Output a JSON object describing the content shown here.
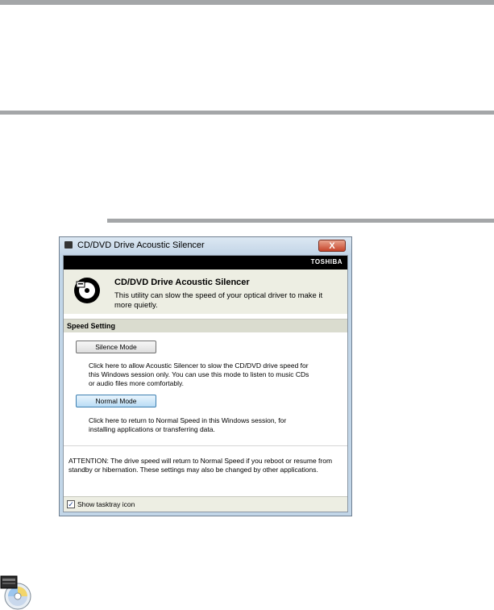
{
  "window": {
    "title": "CD/DVD Drive Acoustic Silencer",
    "close_glyph": "X",
    "brand": "TOSHIBA"
  },
  "header": {
    "title": "CD/DVD Drive Acoustic Silencer",
    "description": "This utility can slow  the speed of  your optical driver to make it more quietly.",
    "icon": "disc-icon"
  },
  "speed_setting": {
    "title": "Speed Setting",
    "silence_button": "Silence Mode",
    "silence_description": "Click here to allow Acoustic Silencer to slow the CD/DVD drive speed for this Windows session only. You can use this mode to listen to music CDs or audio files more comfortably.",
    "normal_button": "Normal Mode",
    "normal_description": "Click here to return to Normal Speed in this Windows session, for installing applications or transferring data."
  },
  "attention": "ATTENTION: The drive speed will return to Normal Speed if you reboot or resume from standby or hibernation. These settings may also be changed by other applications.",
  "footer": {
    "checkbox_label": "Show tasktray icon",
    "checkbox_checked": true,
    "check_glyph": "✓"
  },
  "colors": {
    "rule": "#a4a6a8",
    "window_frame": "#c2d6e8",
    "header_bg": "#edeee3",
    "brand_bar": "#000000"
  }
}
